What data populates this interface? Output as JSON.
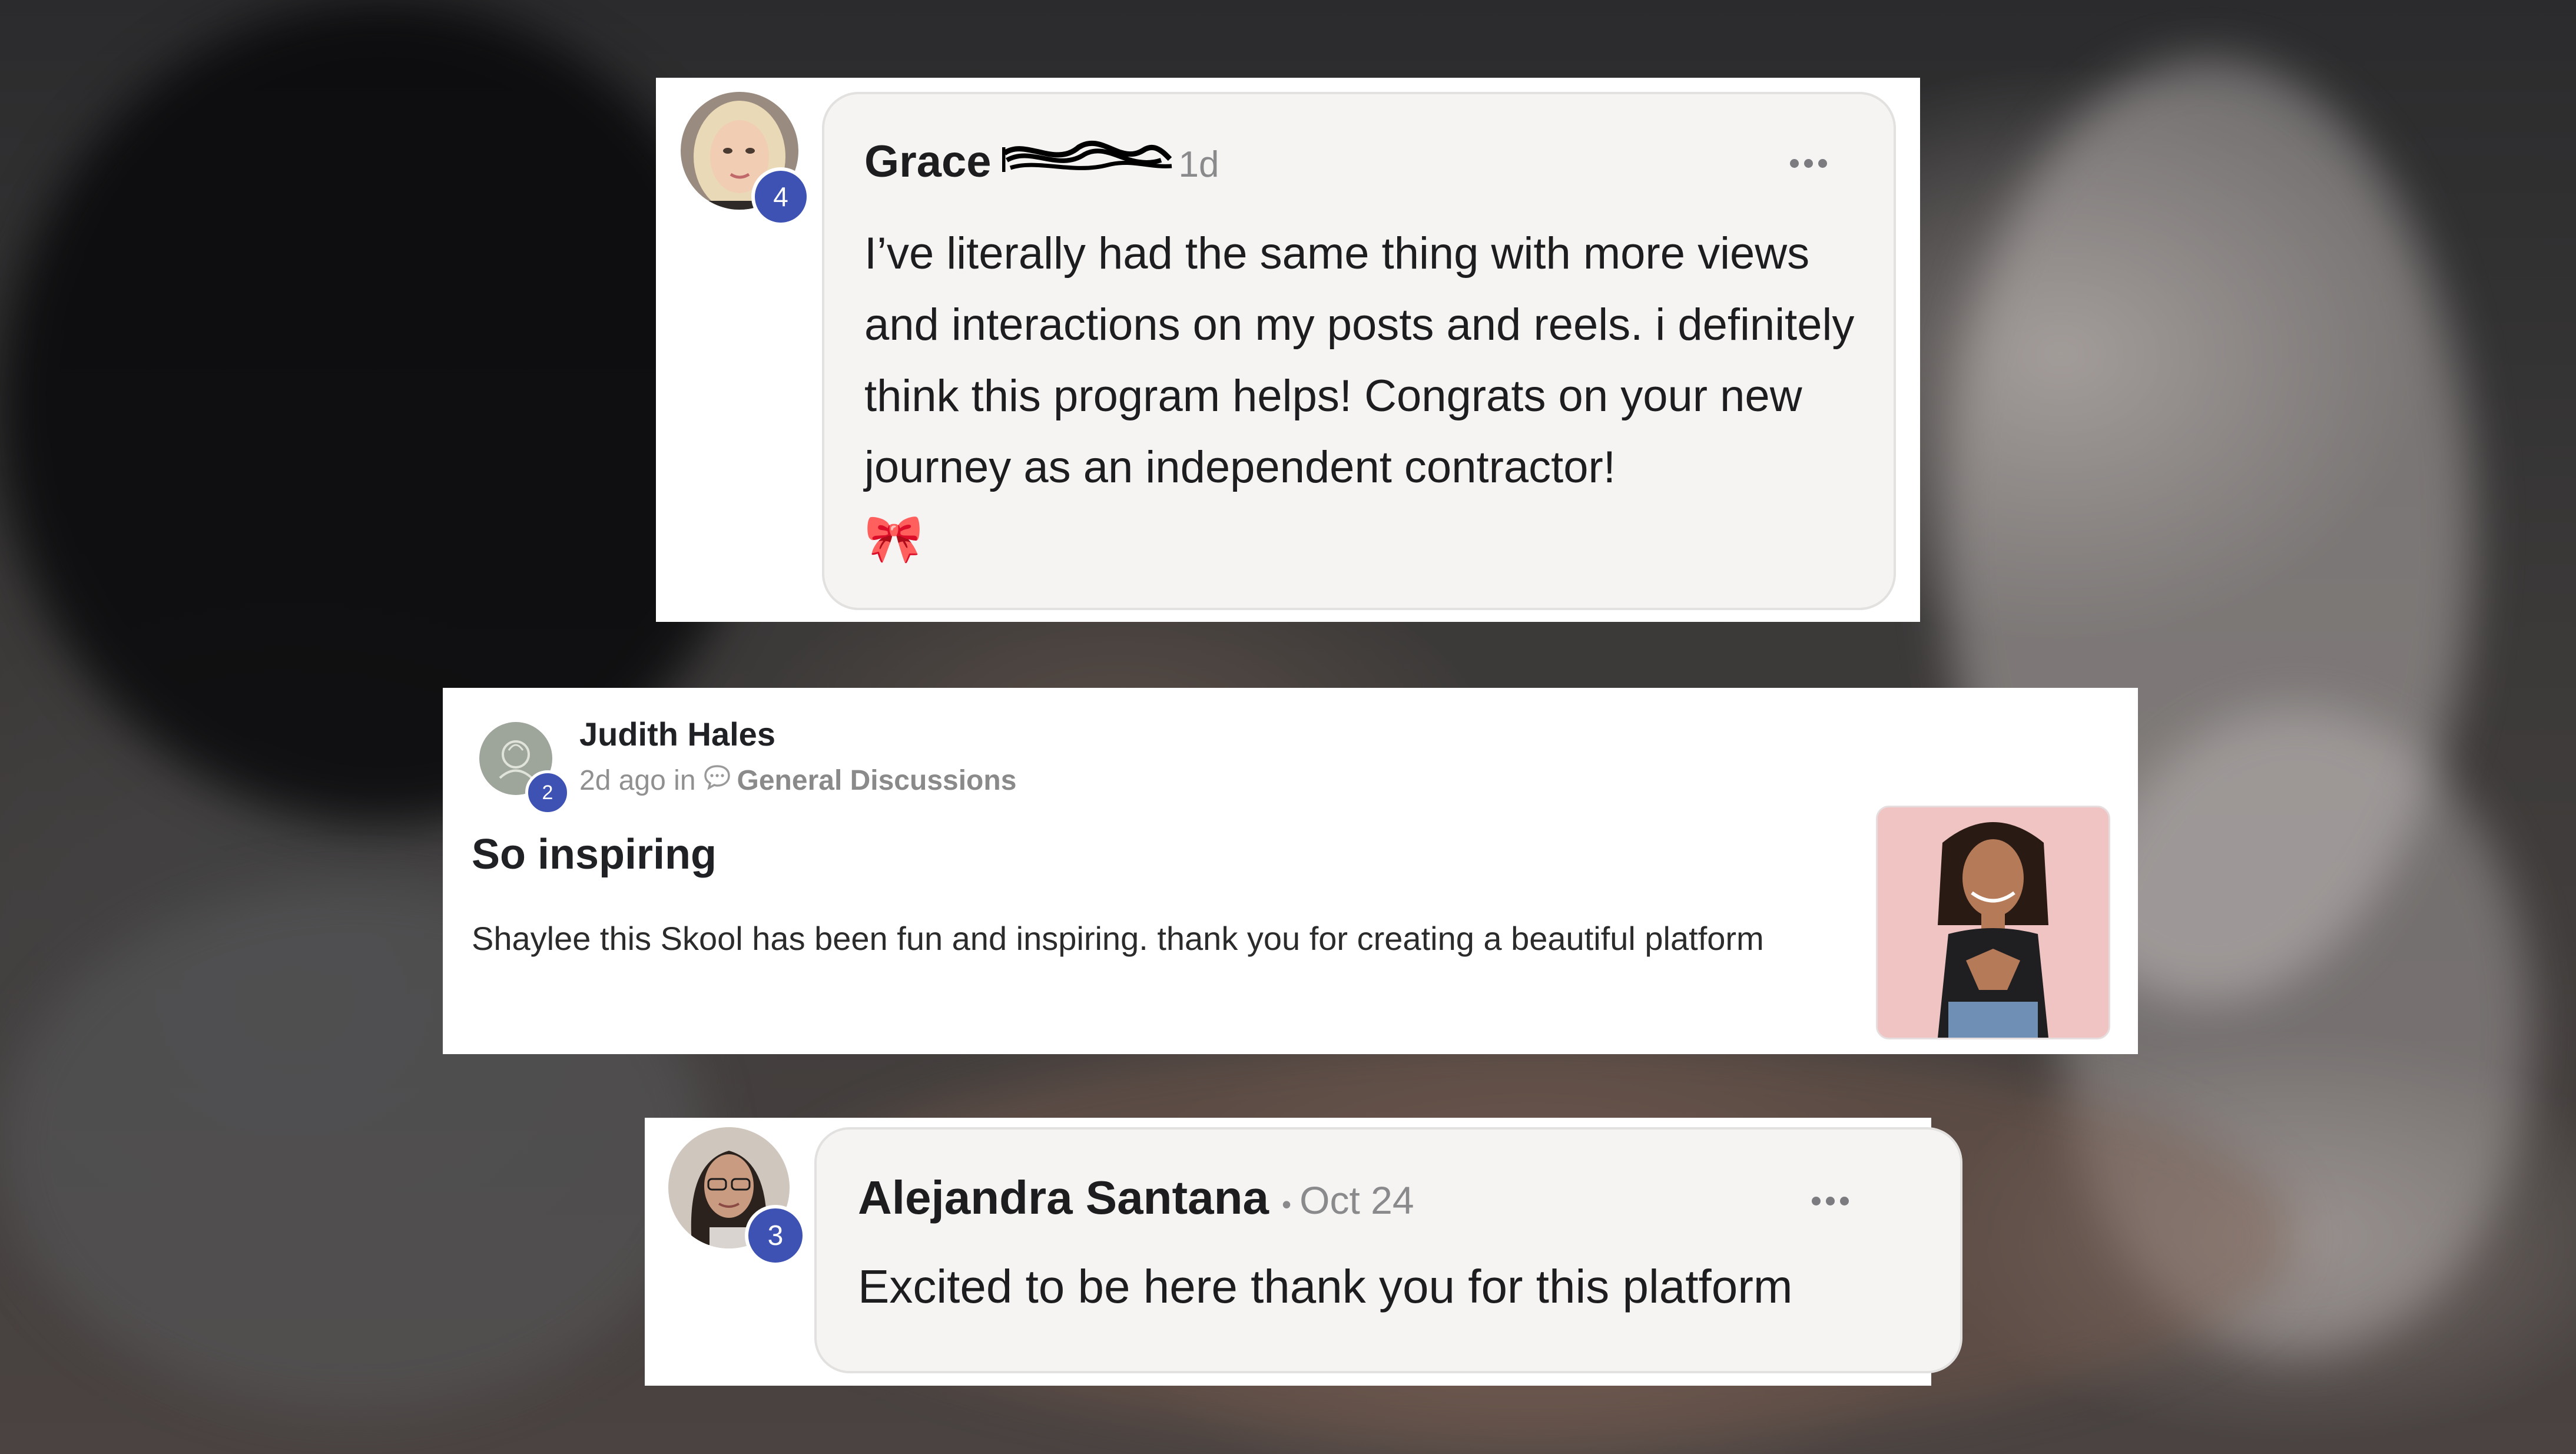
{
  "comments": [
    {
      "author": "Grace",
      "time": "1d",
      "level": "4",
      "text": "I’ve literally had the same thing with more views and interactions on my posts and reels. i definitely think this program helps! Congrats on your new journey as an independent contractor!",
      "emoji": "🎀"
    },
    {
      "author": "Alejandra Santana",
      "separator": "•",
      "time": "Oct 24",
      "level": "3",
      "text": "Excited to be here thank you for this platform"
    }
  ],
  "post": {
    "author": "Judith Hales",
    "level": "2",
    "meta_time": "2d ago in",
    "category": "General Discussions",
    "title": "So inspiring",
    "body": "Shaylee this Skool has been fun and inspiring. thank you for creating a beautiful platform"
  },
  "icons": {
    "more": "more-horizontal-icon",
    "category": "speech-bubble-icon"
  },
  "colors": {
    "level_badge": "#3d52b3",
    "bubble_bg": "#f5f4f3",
    "meta_text": "#8a8a8c"
  }
}
